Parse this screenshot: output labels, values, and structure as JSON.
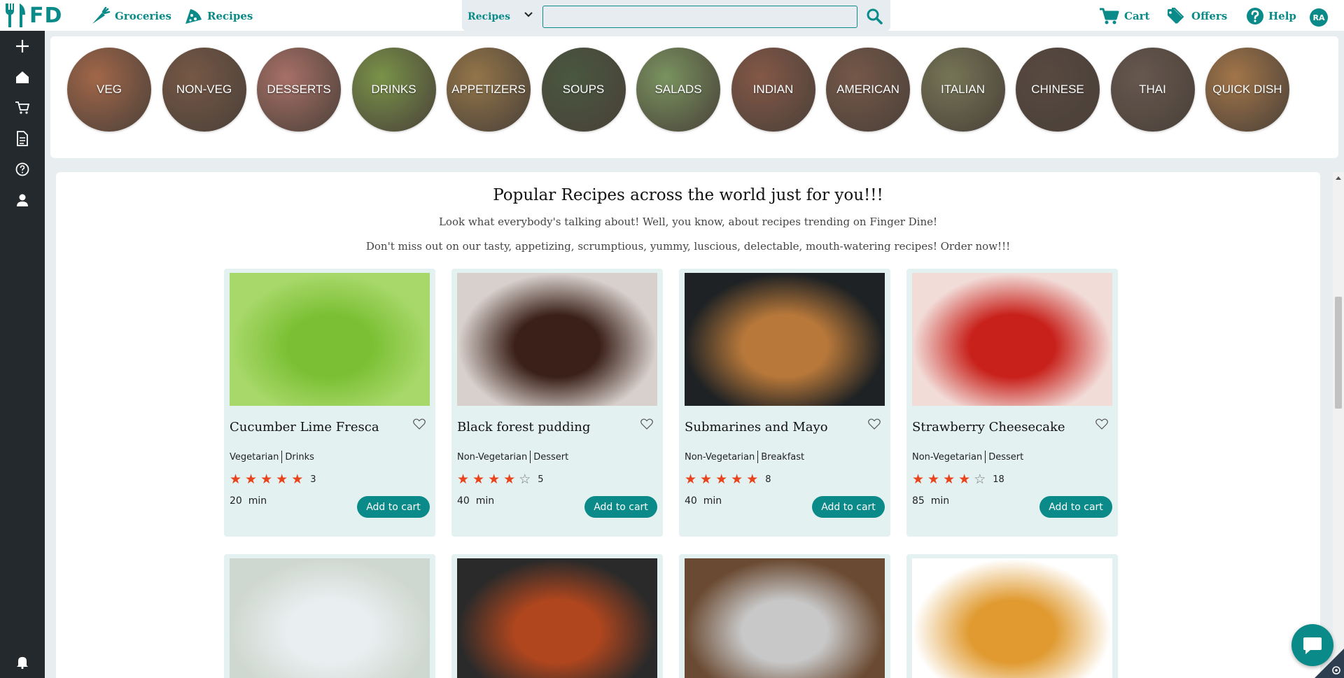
{
  "brand": {
    "logo_text": "FD",
    "accent": "#0a8a88",
    "sidebar_bg": "#24292d"
  },
  "topnav": {
    "groceries": "Groceries",
    "recipes": "Recipes",
    "cart": "Cart",
    "offers": "Offers",
    "help": "Help",
    "avatar_initials": "RA"
  },
  "search": {
    "category": "Recipes",
    "value": "",
    "placeholder": ""
  },
  "sidebar": {
    "icons": [
      "plus-icon",
      "home-icon",
      "cart-icon",
      "document-icon",
      "help-icon",
      "user-icon"
    ],
    "bottom_icon": "bell-icon"
  },
  "categories": [
    {
      "label": "VEG",
      "color": "#9a5a3a"
    },
    {
      "label": "NON-VEG",
      "color": "#6b4a36"
    },
    {
      "label": "DESSERTS",
      "color": "#a0645a"
    },
    {
      "label": "DRINKS",
      "color": "#6e8a3a"
    },
    {
      "label": "APPETIZERS",
      "color": "#8a6a3a"
    },
    {
      "label": "SOUPS",
      "color": "#3a4a30"
    },
    {
      "label": "SALADS",
      "color": "#6e8a52"
    },
    {
      "label": "INDIAN",
      "color": "#7a4a38"
    },
    {
      "label": "AMERICAN",
      "color": "#6a4a3a"
    },
    {
      "label": "ITALIAN",
      "color": "#6a6a48"
    },
    {
      "label": "CHINESE",
      "color": "#4a3a30"
    },
    {
      "label": "THAI",
      "color": "#5a4a40"
    },
    {
      "label": "QUICK DISH",
      "color": "#9a6a3a"
    }
  ],
  "section": {
    "title": "Popular Recipes across the world just for you!!!",
    "line1": "Look what everybody's talking about! Well, you know, about recipes trending on Finger Dine!",
    "line2": "Don't miss out on our tasty, appetizing, scrumptious, yummy, luscious, delectable, mouth-watering recipes! Order now!!!"
  },
  "recipes": [
    {
      "title": "Cucumber Lime Fresca",
      "type": "Vegetarian",
      "category": "Drinks",
      "stars": 5,
      "reviews": "3",
      "time": "20  min",
      "button": "Add to cart",
      "img_bg": "#a8d86a",
      "img_fg": "#7bc034"
    },
    {
      "title": "Black forest pudding",
      "type": "Non-Vegetarian",
      "category": "Dessert",
      "stars": 4,
      "reviews": "5",
      "time": "40  min",
      "button": "Add to cart",
      "img_bg": "#d8d0cc",
      "img_fg": "#3a2018"
    },
    {
      "title": "Submarines and Mayo",
      "type": "Non-Vegetarian",
      "category": "Breakfast",
      "stars": 5,
      "reviews": "8",
      "time": "40  min",
      "button": "Add to cart",
      "img_bg": "#1f2224",
      "img_fg": "#b8783a"
    },
    {
      "title": "Strawberry Cheesecake",
      "type": "Non-Vegetarian",
      "category": "Dessert",
      "stars": 4,
      "reviews": "18",
      "time": "85  min",
      "button": "Add to cart",
      "img_bg": "#f2dcd8",
      "img_fg": "#c8201a"
    },
    {
      "img_bg": "#cfd8d0",
      "img_fg": "#e9eef0"
    },
    {
      "img_bg": "#2a2a2a",
      "img_fg": "#b0461e"
    },
    {
      "img_bg": "#6a4a32",
      "img_fg": "#c8c8c8"
    },
    {
      "img_bg": "#ffffff",
      "img_fg": "#e09a30"
    }
  ]
}
